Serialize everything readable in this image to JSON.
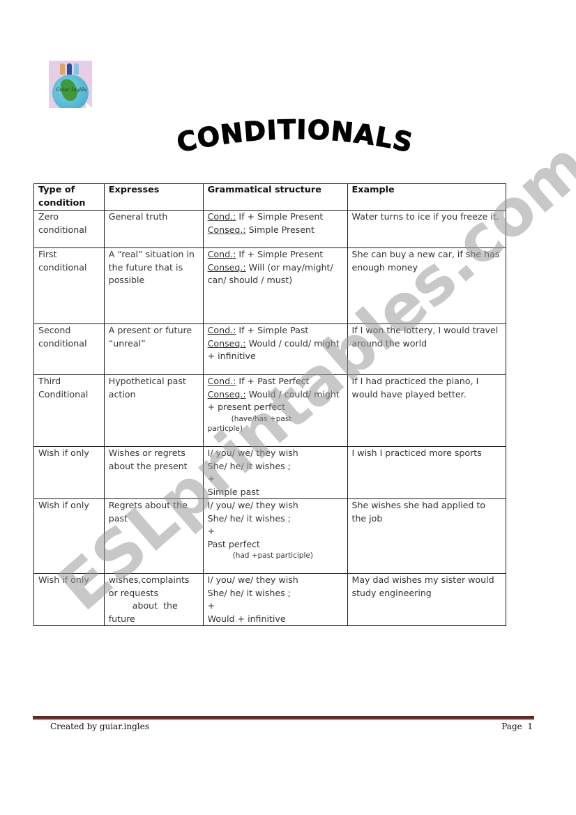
{
  "logo": {
    "text": "Guiar Inglês"
  },
  "title": "CONDITIONALS",
  "table": {
    "headers": [
      "Type of condition",
      "Expresses",
      "Grammatical structure",
      "Example"
    ],
    "rows": [
      {
        "type": "Zero conditional",
        "expresses": "General truth",
        "structure": {
          "cond_label": "Cond.:",
          "cond_text": " If + Simple Present",
          "conseq_label": "Conseq.:",
          "conseq_text": " Simple Present"
        },
        "example": "Water turns to ice if you freeze it."
      },
      {
        "type": "First conditional",
        "expresses": "A “real” situation in the future that is possible",
        "structure": {
          "cond_label": "Cond.:",
          "cond_text": " If + Simple Present",
          "conseq_label": "Conseq.:",
          "conseq_text": " Will (or may/might/ can/ should / must)"
        },
        "example": "She can buy a new car, if she has enough money"
      },
      {
        "type": "Second conditional",
        "expresses": "A present or future “unreal”",
        "structure": {
          "cond_label": "Cond.:",
          "cond_text": " If + Simple Past",
          "conseq_label": "Conseq.:",
          "conseq_text": " Would / could/ might + infinitive"
        },
        "example": "If I won the lottery, I would travel around the world"
      },
      {
        "type": "Third Conditional",
        "expresses": "Hypothetical past action",
        "structure": {
          "cond_label": "Cond.:",
          "cond_text": " If + Past Perfect",
          "conseq_label": "Conseq.:",
          "conseq_text": " Would / could/ might + present perfect",
          "note_a": "(have/has +past",
          "note_b": "particple)"
        },
        "example": "If I had practiced the piano, I would have played better."
      },
      {
        "type": "Wish if only",
        "expresses": "Wishes or regrets about the present",
        "structure": {
          "line1": "I/ you/ we/ they wish",
          "line2": "She/ he/ it wishes ;",
          "line3": "+",
          "line4": "Simple past"
        },
        "example": "I wish I practiced more sports"
      },
      {
        "type": "Wish if only",
        "expresses": "Regrets about the past",
        "structure": {
          "line1": "I/ you/ we/ they wish",
          "line2": "She/ he/ it wishes ;",
          "line3": "+",
          "line4": "Past perfect",
          "note": "(had +past participle)"
        },
        "example": "She wishes she had applied to the job"
      },
      {
        "type": "Wish if only",
        "expresses_a": "wishes,complaints or requests",
        "expresses_b": "about  the",
        "expresses_c": "future",
        "structure": {
          "line1": "I/ you/ we/ they wish",
          "line2": "She/ he/ it wishes ;",
          "line3": "+",
          "line4": "Would + infinitive"
        },
        "example": "May dad wishes my sister would study engineering"
      }
    ]
  },
  "watermark": "ESLprintables.com",
  "footer": {
    "left": "Created by guiar.ingles",
    "right": "Page  1"
  }
}
